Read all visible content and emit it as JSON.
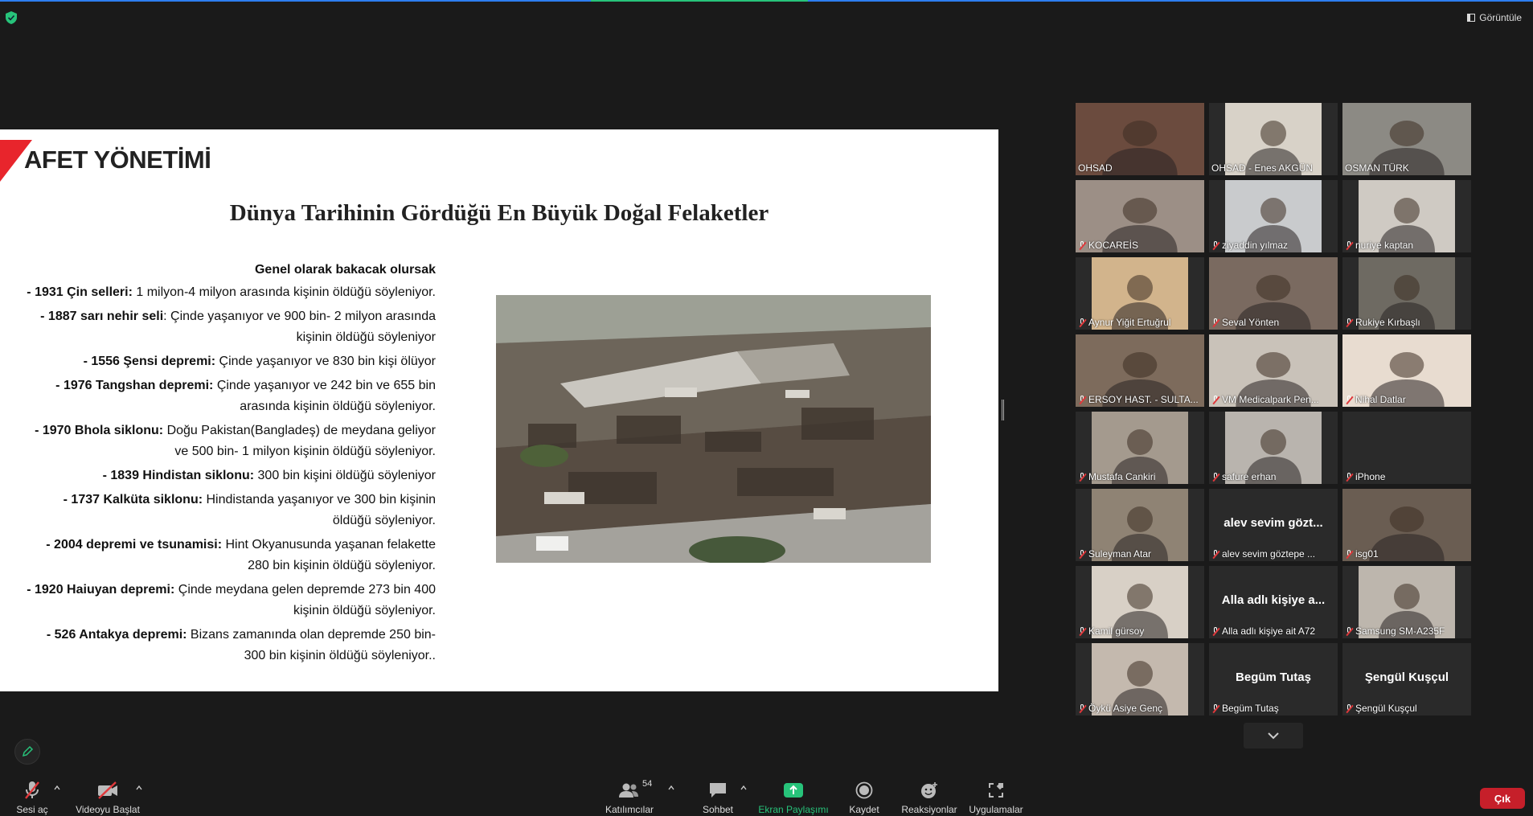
{
  "window": {
    "view_label": "Görüntüle"
  },
  "slide": {
    "brand": "AFET YÖNETİMİ",
    "heading": "Dünya Tarihinin Gördüğü En Büyük Doğal Felaketler",
    "intro": "Genel olarak bakacak olursak",
    "items": [
      {
        "bold": "- 1931 Çin selleri:",
        "text": " 1 milyon-4 milyon arasında kişinin öldüğü söyleniyor."
      },
      {
        "bold": "- 1887 sarı nehir seli",
        "text": ": Çinde yaşanıyor ve 900 bin- 2 milyon arasında kişinin öldüğü söyleniyor"
      },
      {
        "bold": "- 1556 Şensi depremi:",
        "text": " Çinde yaşanıyor ve 830 bin kişi ölüyor"
      },
      {
        "bold": "- 1976 Tangshan depremi:",
        "text": " Çinde yaşanıyor ve 242 bin ve 655 bin arasında kişinin öldüğü söyleniyor."
      },
      {
        "bold": "- 1970 Bhola siklonu:",
        "text": " Doğu Pakistan(Bangladeş) de meydana geliyor ve 500 bin- 1 milyon kişinin öldüğü söyleniyor."
      },
      {
        "bold": "- 1839 Hindistan siklonu:",
        "text": " 300 bin kişini öldüğü söyleniyor"
      },
      {
        "bold": "- 1737 Kalküta siklonu:",
        "text": " Hindistanda yaşanıyor ve 300 bin kişinin öldüğü söyleniyor."
      },
      {
        "bold": "- 2004 depremi ve tsunamisi:",
        "text": " Hint Okyanusunda yaşanan felakette 280 bin kişinin öldüğü söyleniyor."
      },
      {
        "bold": "- 1920 Haiuyan depremi:",
        "text": " Çinde meydana gelen depremde 273 bin 400 kişinin öldüğü söyleniyor."
      },
      {
        "bold": "- 526 Antakya depremi:",
        "text": " Bizans zamanında olan depremde 250 bin- 300 bin kişinin öldüğü söyleniyor.."
      }
    ]
  },
  "participants": [
    {
      "name": "OHSAD",
      "muted": false,
      "video": true,
      "bg": "#6b4b3e",
      "active": false,
      "big": ""
    },
    {
      "name": "OHSAD - Enes AKGÜN",
      "muted": false,
      "video": true,
      "bg": "#d8d2c8",
      "active": false,
      "big": ""
    },
    {
      "name": "OSMAN TÜRK",
      "muted": false,
      "video": true,
      "bg": "#8c8a84",
      "active": true,
      "big": ""
    },
    {
      "name": "KOCAREİS",
      "muted": true,
      "video": true,
      "bg": "#9c8f86",
      "active": false,
      "big": ""
    },
    {
      "name": "ziyaddin yılmaz",
      "muted": true,
      "video": true,
      "bg": "#c9cbcd",
      "active": false,
      "big": ""
    },
    {
      "name": "nuriye kaptan",
      "muted": true,
      "video": true,
      "bg": "#cfcac3",
      "active": false,
      "big": ""
    },
    {
      "name": "Aynur Yiğit Ertuğrul",
      "muted": true,
      "video": true,
      "bg": "#d2b48c",
      "active": false,
      "big": ""
    },
    {
      "name": "Seval Yönten",
      "muted": true,
      "video": true,
      "bg": "#7a6a60",
      "active": false,
      "big": ""
    },
    {
      "name": "Rukiye Kırbaşlı",
      "muted": true,
      "video": true,
      "bg": "#6e6a62",
      "active": false,
      "big": ""
    },
    {
      "name": "ERSOY HAST. - SULTA...",
      "muted": true,
      "video": true,
      "bg": "#7d6b5c",
      "active": false,
      "big": ""
    },
    {
      "name": "VM Medicalpark Pen...",
      "muted": true,
      "video": true,
      "bg": "#c9c2b9",
      "active": false,
      "big": ""
    },
    {
      "name": "Nihal Datlar",
      "muted": true,
      "video": true,
      "bg": "#e8dcd0",
      "active": false,
      "big": ""
    },
    {
      "name": "Mustafa Cankiri",
      "muted": true,
      "video": true,
      "bg": "#a49a8e",
      "active": false,
      "big": ""
    },
    {
      "name": "safure erhan",
      "muted": true,
      "video": true,
      "bg": "#b9b4ae",
      "active": false,
      "big": ""
    },
    {
      "name": "iPhone",
      "muted": true,
      "video": false,
      "bg": "#1f1f1f",
      "active": false,
      "big": ""
    },
    {
      "name": "Suleyman Atar",
      "muted": true,
      "video": true,
      "bg": "#8f8374",
      "active": false,
      "big": ""
    },
    {
      "name": "alev sevim göztepe ...",
      "muted": true,
      "video": false,
      "bg": "#242424",
      "active": false,
      "big": "alev sevim gözt..."
    },
    {
      "name": "isg01",
      "muted": true,
      "video": true,
      "bg": "#6a5d52",
      "active": false,
      "big": ""
    },
    {
      "name": "Kamil gürsoy",
      "muted": true,
      "video": true,
      "bg": "#d8d0c6",
      "active": false,
      "big": ""
    },
    {
      "name": "Alla adlı kişiye ait A72",
      "muted": true,
      "video": false,
      "bg": "#242424",
      "active": false,
      "big": "Alla adlı kişiye a..."
    },
    {
      "name": "Samsung SM-A235F",
      "muted": true,
      "video": true,
      "bg": "#bdb6ad",
      "active": false,
      "big": ""
    },
    {
      "name": "Öykü Asiye Genç",
      "muted": true,
      "video": true,
      "bg": "#c4b9ae",
      "active": false,
      "big": ""
    },
    {
      "name": "Begüm Tutaş",
      "muted": true,
      "video": false,
      "bg": "#242424",
      "active": false,
      "big": "Begüm Tutaş"
    },
    {
      "name": "Şengül Kuşçul",
      "muted": true,
      "video": false,
      "bg": "#242424",
      "active": false,
      "big": "Şengül Kuşçul"
    }
  ],
  "toolbar": {
    "unmute": "Sesi aç",
    "start_video": "Videoyu Başlat",
    "participants": "Katılımcılar",
    "participant_count": "54",
    "chat": "Sohbet",
    "share": "Ekran Paylaşımı",
    "record": "Kaydet",
    "reactions": "Reaksiyonlar",
    "apps": "Uygulamalar",
    "leave": "Çık"
  },
  "colors": {
    "accent_green": "#27c37a",
    "active_speaker": "#d7e33d",
    "leave_red": "#c61f2a",
    "slide_red": "#e8252c"
  }
}
